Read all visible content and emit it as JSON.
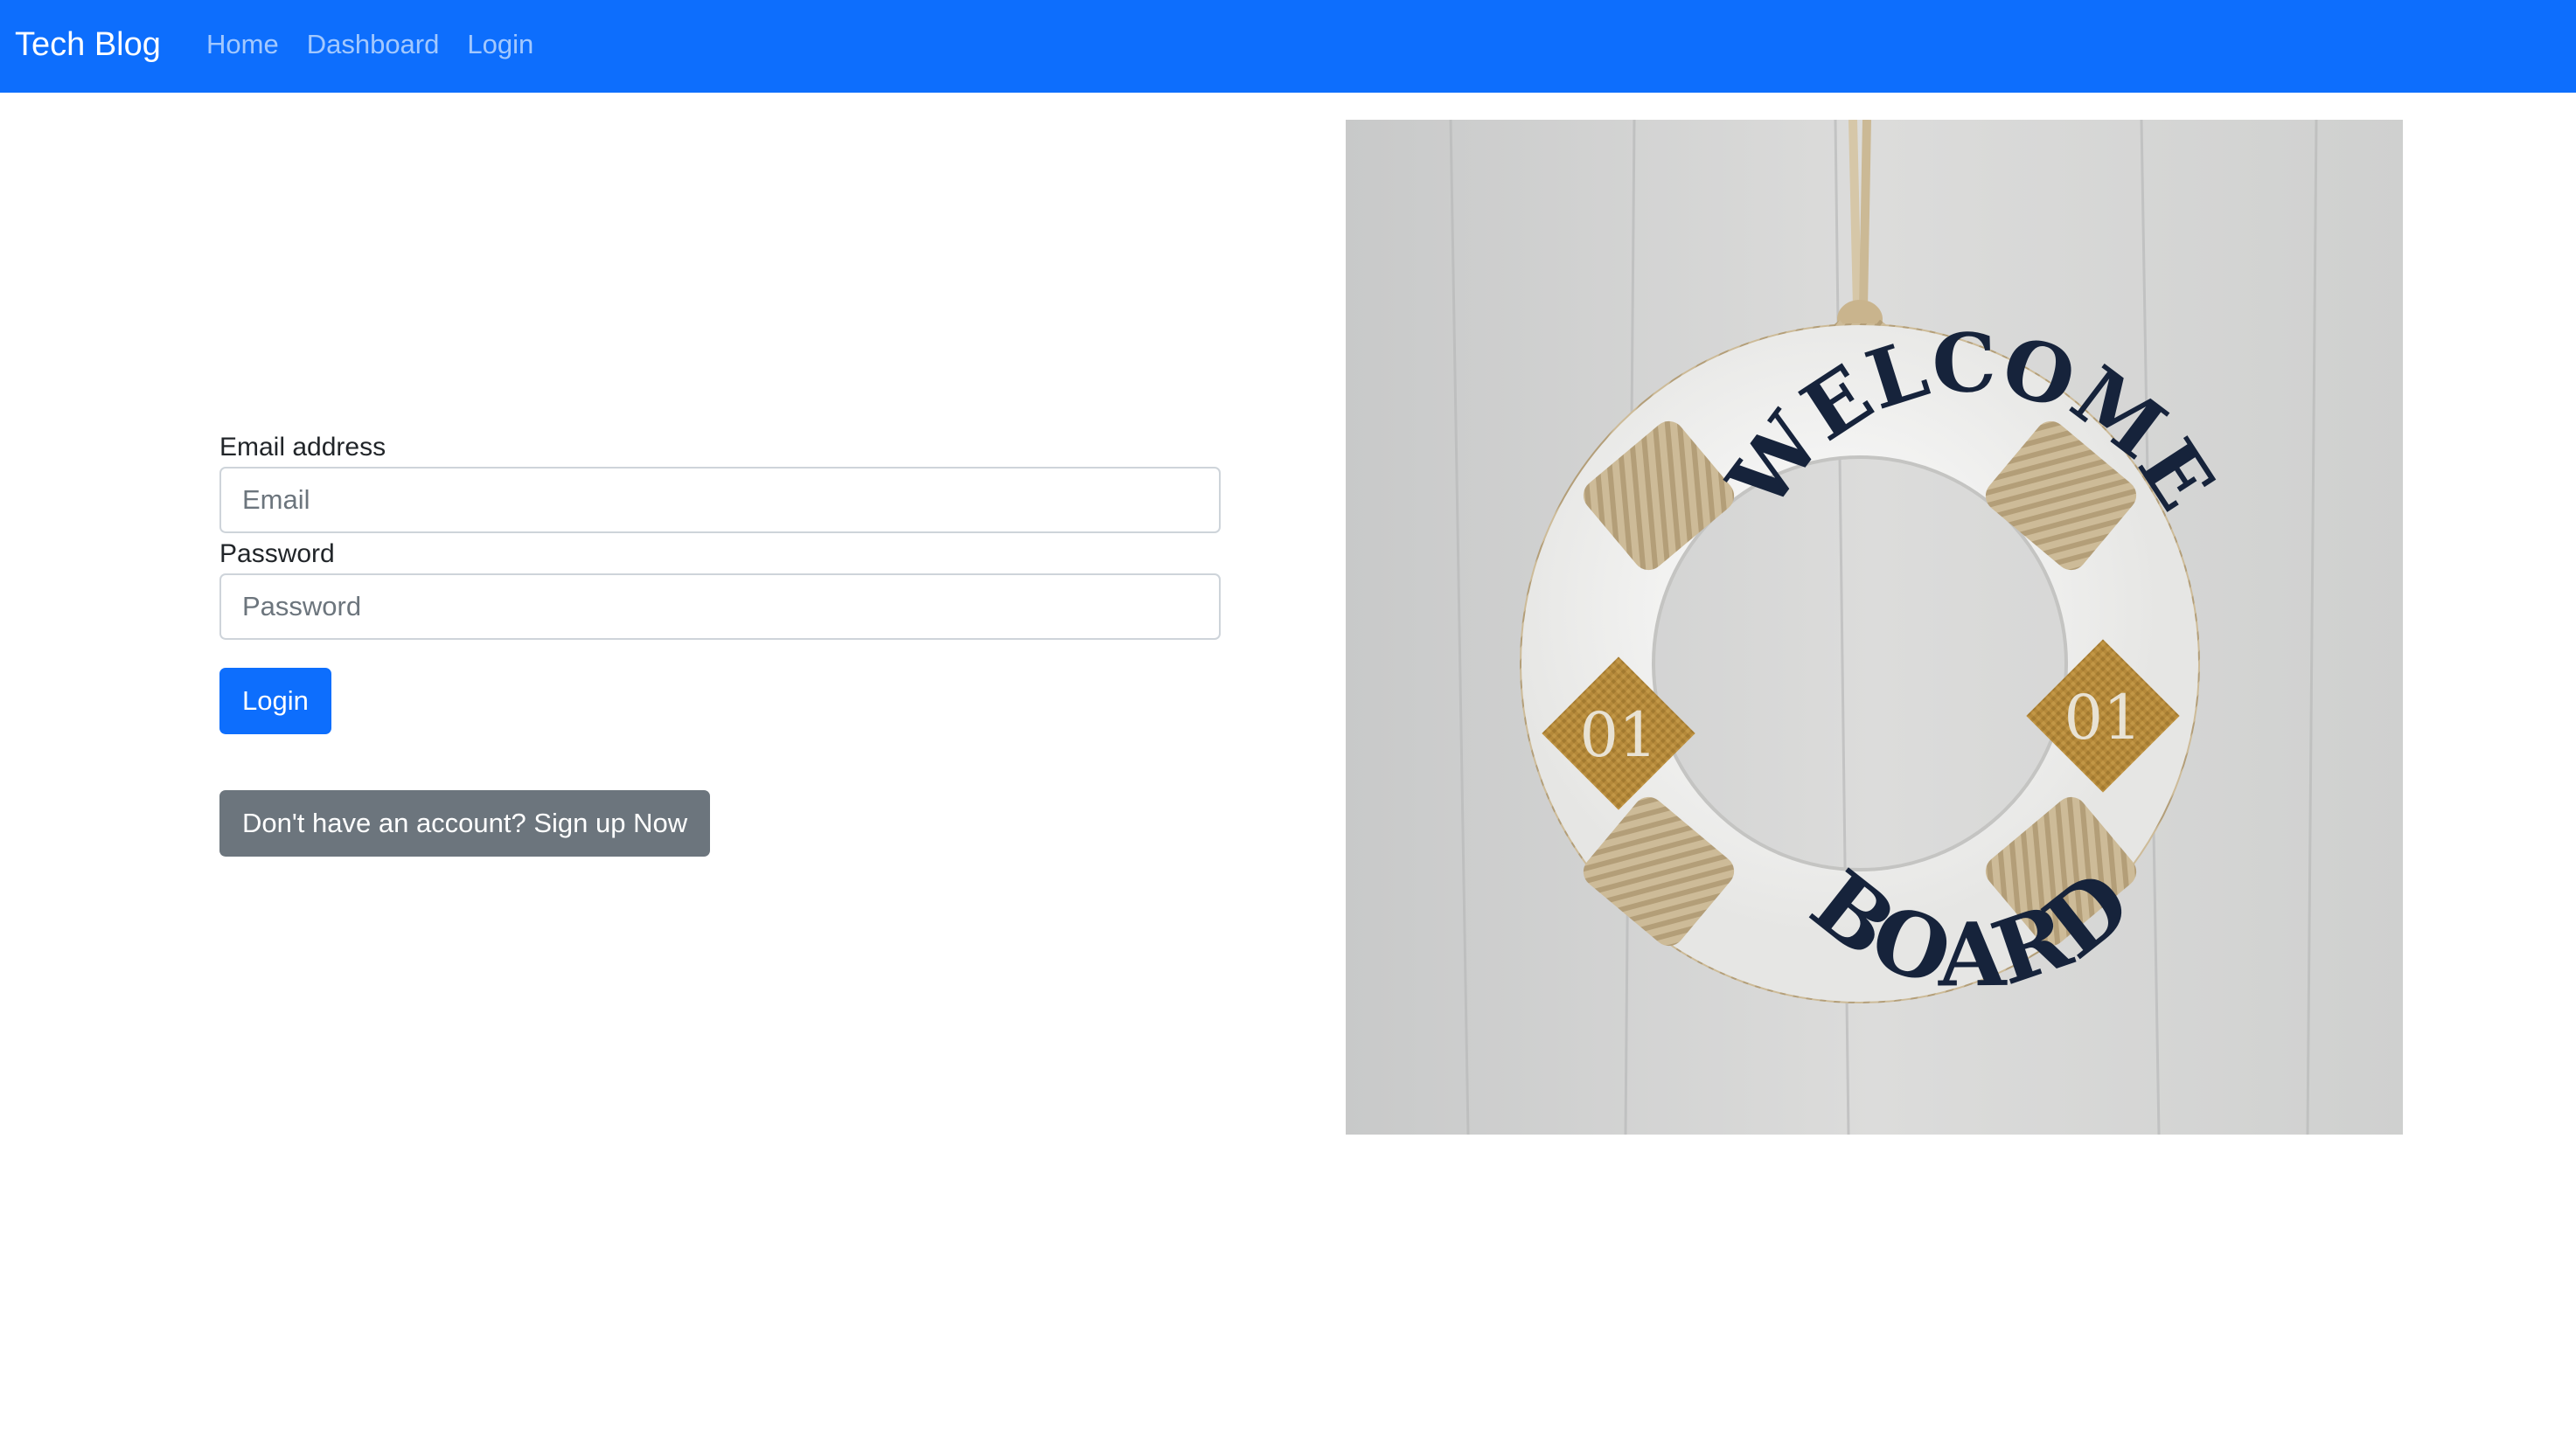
{
  "navbar": {
    "brand": "Tech Blog",
    "links": [
      "Home",
      "Dashboard",
      "Login"
    ],
    "bg_color": "#0d6efd"
  },
  "form": {
    "email_label": "Email address",
    "email_placeholder": "Email",
    "password_label": "Password",
    "password_placeholder": "Password",
    "login_button": "Login",
    "signup_button": "Don't have an account? Sign up Now"
  },
  "photo": {
    "ring_top_text": "WELCOME",
    "ring_bottom_text": "BOARD",
    "patch_left_text": "01",
    "patch_right_text": "01"
  }
}
